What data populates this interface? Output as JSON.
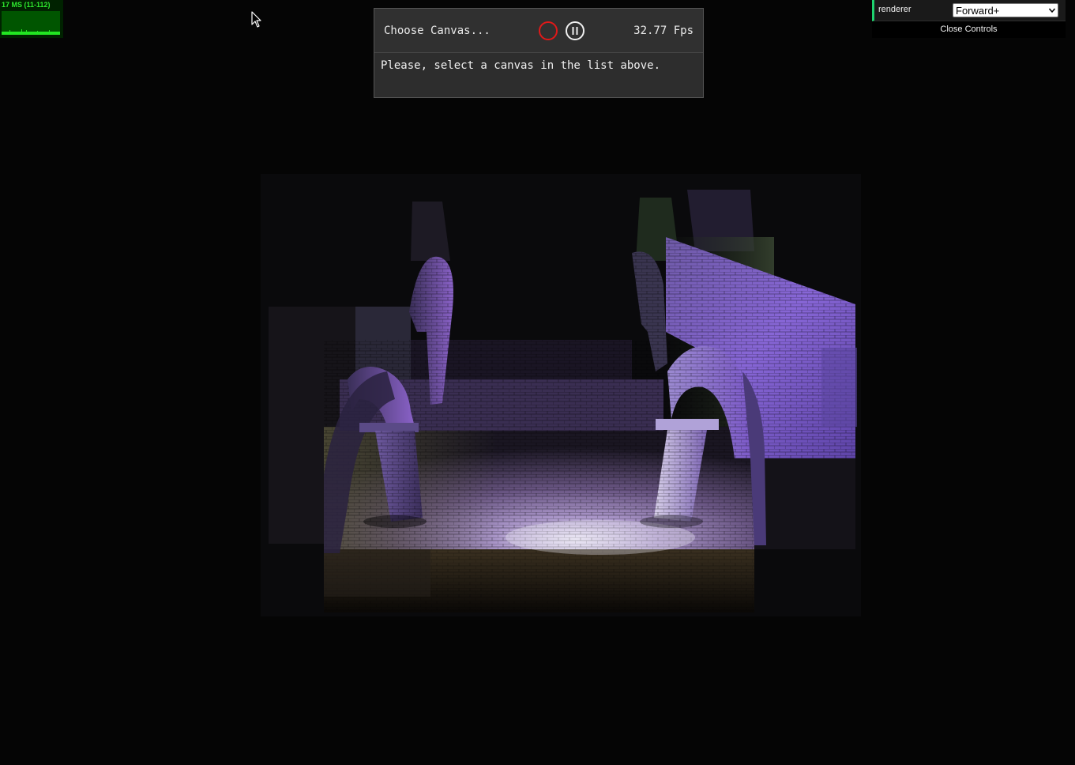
{
  "stats": {
    "text": "17 MS (11-112)"
  },
  "capture_menu": {
    "canvas_chooser_label": "Choose Canvas...",
    "fps_label": "32.77 Fps",
    "message": "Please, select a canvas in the list above."
  },
  "controls": {
    "renderer_label": "renderer",
    "renderer_value": "Forward+",
    "close_label": "Close Controls"
  },
  "colors": {
    "background": "#040404",
    "stats_text": "#2ee82e",
    "stats_bg": "#002200",
    "record_red": "#e01919",
    "gui_accent": "#1ed36f",
    "stone_purple": "#8a5fd8",
    "stone_warm": "#c7b58a"
  },
  "icons": {
    "record": "record-icon",
    "pause": "pause-icon",
    "dropdown": "chevron-down-icon",
    "cursor": "mouse-cursor-icon"
  }
}
